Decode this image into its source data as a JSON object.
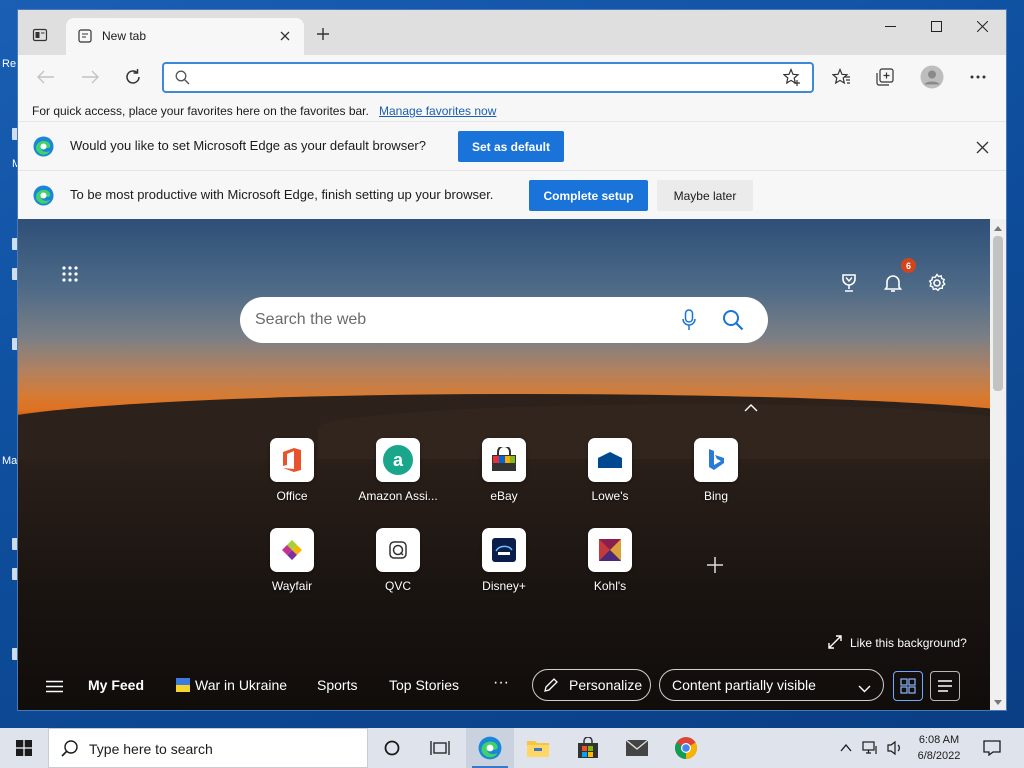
{
  "desktop": {
    "fragments": [
      "Re",
      "M",
      "Ma"
    ]
  },
  "browser": {
    "tab": {
      "title": "New tab"
    },
    "address": {
      "placeholder": "",
      "value": ""
    },
    "favorites_bar": {
      "text": "For quick access, place your favorites here on the favorites bar.",
      "link": "Manage favorites now"
    },
    "infobar_default": {
      "message": "Would you like to set Microsoft Edge as your default browser?",
      "button": "Set as default"
    },
    "infobar_setup": {
      "message": "To be most productive with Microsoft Edge, finish setting up your browser.",
      "primary_button": "Complete setup",
      "secondary_button": "Maybe later"
    }
  },
  "ntp": {
    "notification_count": "6",
    "search_placeholder": "Search the web",
    "tiles": [
      {
        "label": "Office",
        "icon": "office-icon"
      },
      {
        "label": "Amazon Assi...",
        "icon": "amazon-icon"
      },
      {
        "label": "eBay",
        "icon": "ebay-icon"
      },
      {
        "label": "Lowe's",
        "icon": "lowes-icon"
      },
      {
        "label": "Bing",
        "icon": "bing-icon"
      },
      {
        "label": "Wayfair",
        "icon": "wayfair-icon"
      },
      {
        "label": "QVC",
        "icon": "qvc-icon"
      },
      {
        "label": "Disney+",
        "icon": "disney-icon"
      },
      {
        "label": "Kohl's",
        "icon": "kohls-icon"
      }
    ],
    "background_link": "Like this background?",
    "feed": {
      "my_feed": "My Feed",
      "items": [
        "War in Ukraine",
        "Sports",
        "Top Stories"
      ],
      "more": "···",
      "personalize": "Personalize",
      "content_visibility": "Content partially visible"
    }
  },
  "taskbar": {
    "search_placeholder": "Type here to search",
    "time": "6:08 AM",
    "date": "6/8/2022"
  },
  "colors": {
    "accent": "#1a73d9",
    "badge": "#d4441b",
    "taskbar": "#dfe4ec"
  }
}
